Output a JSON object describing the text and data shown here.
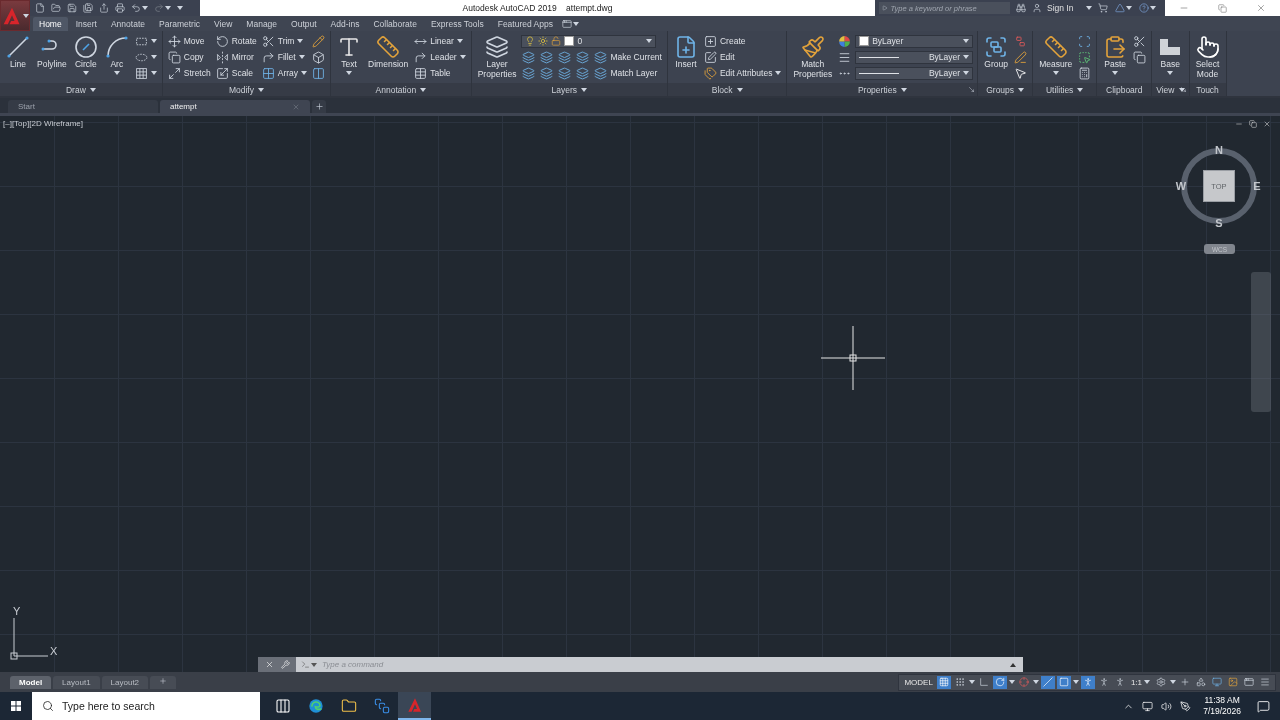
{
  "title_bar": {
    "app": "Autodesk AutoCAD 2019",
    "file": "attempt.dwg",
    "search_placeholder": "Type a keyword or phrase",
    "sign_in": "Sign In"
  },
  "ribbon_tabs": [
    {
      "label": "Home",
      "selected": true
    },
    {
      "label": "Insert",
      "selected": false
    },
    {
      "label": "Annotate",
      "selected": false
    },
    {
      "label": "Parametric",
      "selected": false
    },
    {
      "label": "View",
      "selected": false
    },
    {
      "label": "Manage",
      "selected": false
    },
    {
      "label": "Output",
      "selected": false
    },
    {
      "label": "Add-ins",
      "selected": false
    },
    {
      "label": "Collaborate",
      "selected": false
    },
    {
      "label": "Express Tools",
      "selected": false
    },
    {
      "label": "Featured Apps",
      "selected": false
    }
  ],
  "panels": [
    {
      "title": "Draw",
      "dropdown": true,
      "launcher": false,
      "large": [
        {
          "label": "Line",
          "dropdown": false
        },
        {
          "label": "Polyline",
          "dropdown": false
        },
        {
          "label": "Circle",
          "dropdown": true
        },
        {
          "label": "Arc",
          "dropdown": true
        }
      ],
      "rows": [
        [
          {
            "kind": "tool",
            "dropdown": true
          }
        ],
        [
          {
            "kind": "tool",
            "dropdown": true
          }
        ],
        [
          {
            "kind": "tool",
            "dropdown": true
          }
        ]
      ]
    },
    {
      "title": "Modify",
      "dropdown": true,
      "launcher": false,
      "rows": [
        [
          {
            "kind": "tool",
            "label": "Move"
          },
          {
            "kind": "tool",
            "label": "Rotate"
          },
          {
            "kind": "tool",
            "label": "Trim",
            "dropdown": true
          },
          {
            "kind": "tool"
          }
        ],
        [
          {
            "kind": "tool",
            "label": "Copy"
          },
          {
            "kind": "tool",
            "label": "Mirror"
          },
          {
            "kind": "tool",
            "label": "Fillet",
            "dropdown": true
          },
          {
            "kind": "tool"
          }
        ],
        [
          {
            "kind": "tool",
            "label": "Stretch"
          },
          {
            "kind": "tool",
            "label": "Scale"
          },
          {
            "kind": "tool",
            "label": "Array",
            "dropdown": true
          },
          {
            "kind": "tool"
          }
        ]
      ]
    },
    {
      "title": "Annotation",
      "dropdown": true,
      "launcher": false,
      "large": [
        {
          "label": "Text",
          "dropdown": true
        },
        {
          "label": "Dimension",
          "dropdown": false
        }
      ],
      "rows": [
        [
          {
            "kind": "tool",
            "label": "Linear",
            "dropdown": true
          }
        ],
        [
          {
            "kind": "tool",
            "label": "Leader",
            "dropdown": true
          }
        ],
        [
          {
            "kind": "tool",
            "label": "Table"
          }
        ]
      ]
    },
    {
      "title": "Layers",
      "dropdown": true,
      "launcher": false,
      "large": [
        {
          "label": "Layer Properties",
          "dropdown": false
        }
      ],
      "rows": [
        [
          {
            "kind": "combo",
            "value": "0"
          }
        ],
        [
          {
            "kind": "tool"
          },
          {
            "kind": "tool"
          },
          {
            "kind": "tool"
          },
          {
            "kind": "tool"
          },
          {
            "kind": "tool",
            "label": "Make Current"
          }
        ],
        [
          {
            "kind": "tool"
          },
          {
            "kind": "tool"
          },
          {
            "kind": "tool"
          },
          {
            "kind": "tool"
          },
          {
            "kind": "tool",
            "label": "Match Layer"
          }
        ]
      ]
    },
    {
      "title": "Block",
      "dropdown": true,
      "launcher": false,
      "large": [
        {
          "label": "Insert",
          "dropdown": false
        }
      ],
      "rows": [
        [
          {
            "kind": "tool",
            "label": "Create"
          }
        ],
        [
          {
            "kind": "tool",
            "label": "Edit"
          }
        ],
        [
          {
            "kind": "tool",
            "label": "Edit Attributes",
            "dropdown": true
          }
        ]
      ]
    },
    {
      "title": "Properties",
      "dropdown": true,
      "launcher": true,
      "large": [
        {
          "label": "Match Properties",
          "dropdown": false
        }
      ],
      "rows": [
        [
          {
            "kind": "tool"
          },
          {
            "kind": "combo",
            "value": "ByLayer"
          }
        ],
        [
          {
            "kind": "tool"
          },
          {
            "kind": "combo",
            "value": "ByLayer"
          }
        ],
        [
          {
            "kind": "tool"
          },
          {
            "kind": "combo",
            "value": "ByLayer"
          }
        ]
      ]
    },
    {
      "title": "Groups",
      "dropdown": true,
      "launcher": false,
      "large": [
        {
          "label": "Group",
          "dropdown": false
        }
      ],
      "rows": [
        [
          {
            "kind": "tool"
          }
        ],
        [
          {
            "kind": "tool"
          }
        ],
        [
          {
            "kind": "tool"
          }
        ]
      ]
    },
    {
      "title": "Utilities",
      "dropdown": true,
      "launcher": false,
      "large": [
        {
          "label": "Measure",
          "dropdown": true
        }
      ],
      "rows": [
        [
          {
            "kind": "tool"
          }
        ],
        [
          {
            "kind": "tool"
          }
        ],
        [
          {
            "kind": "tool"
          }
        ]
      ]
    },
    {
      "title": "Clipboard",
      "dropdown": false,
      "launcher": false,
      "large": [
        {
          "label": "Paste",
          "dropdown": true
        }
      ],
      "rows": [
        [
          {
            "kind": "tool"
          }
        ],
        [
          {
            "kind": "tool"
          }
        ]
      ]
    },
    {
      "title": "View",
      "dropdown": true,
      "launcher": true,
      "large": [
        {
          "label": "Base",
          "dropdown": true
        }
      ]
    },
    {
      "title": "Touch",
      "dropdown": false,
      "launcher": false,
      "large": [
        {
          "label": "Select Mode",
          "dropdown": false
        }
      ]
    }
  ],
  "document_tabs": [
    {
      "label": "Start",
      "selected": false,
      "closable": false
    },
    {
      "label": "attempt",
      "selected": true,
      "closable": true
    }
  ],
  "viewport": {
    "label": "[–][Top][2D Wireframe]",
    "viewcube": {
      "north": "N",
      "south": "S",
      "east": "E",
      "west": "W",
      "face": "TOP",
      "ucs": "WCS"
    },
    "ucs_icon": {
      "x": "X",
      "y": "Y"
    }
  },
  "command_line": {
    "placeholder": "Type a command"
  },
  "layout_tabs": [
    {
      "label": "Model",
      "selected": true
    },
    {
      "label": "Layout1",
      "selected": false
    },
    {
      "label": "Layout2",
      "selected": false
    }
  ],
  "status_bar": [
    {
      "kind": "text",
      "label": "MODEL"
    },
    {
      "kind": "toggle",
      "on": true,
      "dropdown": false
    },
    {
      "kind": "toggle",
      "on": false,
      "dropdown": true
    },
    {
      "kind": "toggle",
      "on": false,
      "dropdown": false
    },
    {
      "kind": "toggle",
      "on": true,
      "dropdown": true
    },
    {
      "kind": "toggle",
      "on": false,
      "dropdown": true
    },
    {
      "kind": "toggle",
      "on": true,
      "dropdown": false
    },
    {
      "kind": "toggle",
      "on": true,
      "dropdown": true
    },
    {
      "kind": "toggle",
      "on": true,
      "dropdown": false
    },
    {
      "kind": "toggle",
      "on": false,
      "dropdown": false
    },
    {
      "kind": "toggle",
      "on": false,
      "dropdown": false
    },
    {
      "kind": "text",
      "label": "1:1",
      "dropdown": true
    },
    {
      "kind": "toggle",
      "on": false,
      "dropdown": true
    },
    {
      "kind": "toggle",
      "on": false,
      "dropdown": false
    },
    {
      "kind": "toggle",
      "on": false,
      "dropdown": false
    },
    {
      "kind": "toggle",
      "on": false,
      "dropdown": false
    },
    {
      "kind": "toggle",
      "on": false,
      "dropdown": false
    },
    {
      "kind": "toggle",
      "on": false,
      "dropdown": false
    },
    {
      "kind": "toggle",
      "on": false,
      "dropdown": false
    }
  ],
  "taskbar": {
    "search_placeholder": "Type here to search",
    "apps": [
      {
        "selected": false
      },
      {
        "selected": false
      },
      {
        "selected": false
      },
      {
        "selected": false
      },
      {
        "selected": true
      }
    ],
    "time": "11:38 AM",
    "date": "7/19/2026"
  }
}
